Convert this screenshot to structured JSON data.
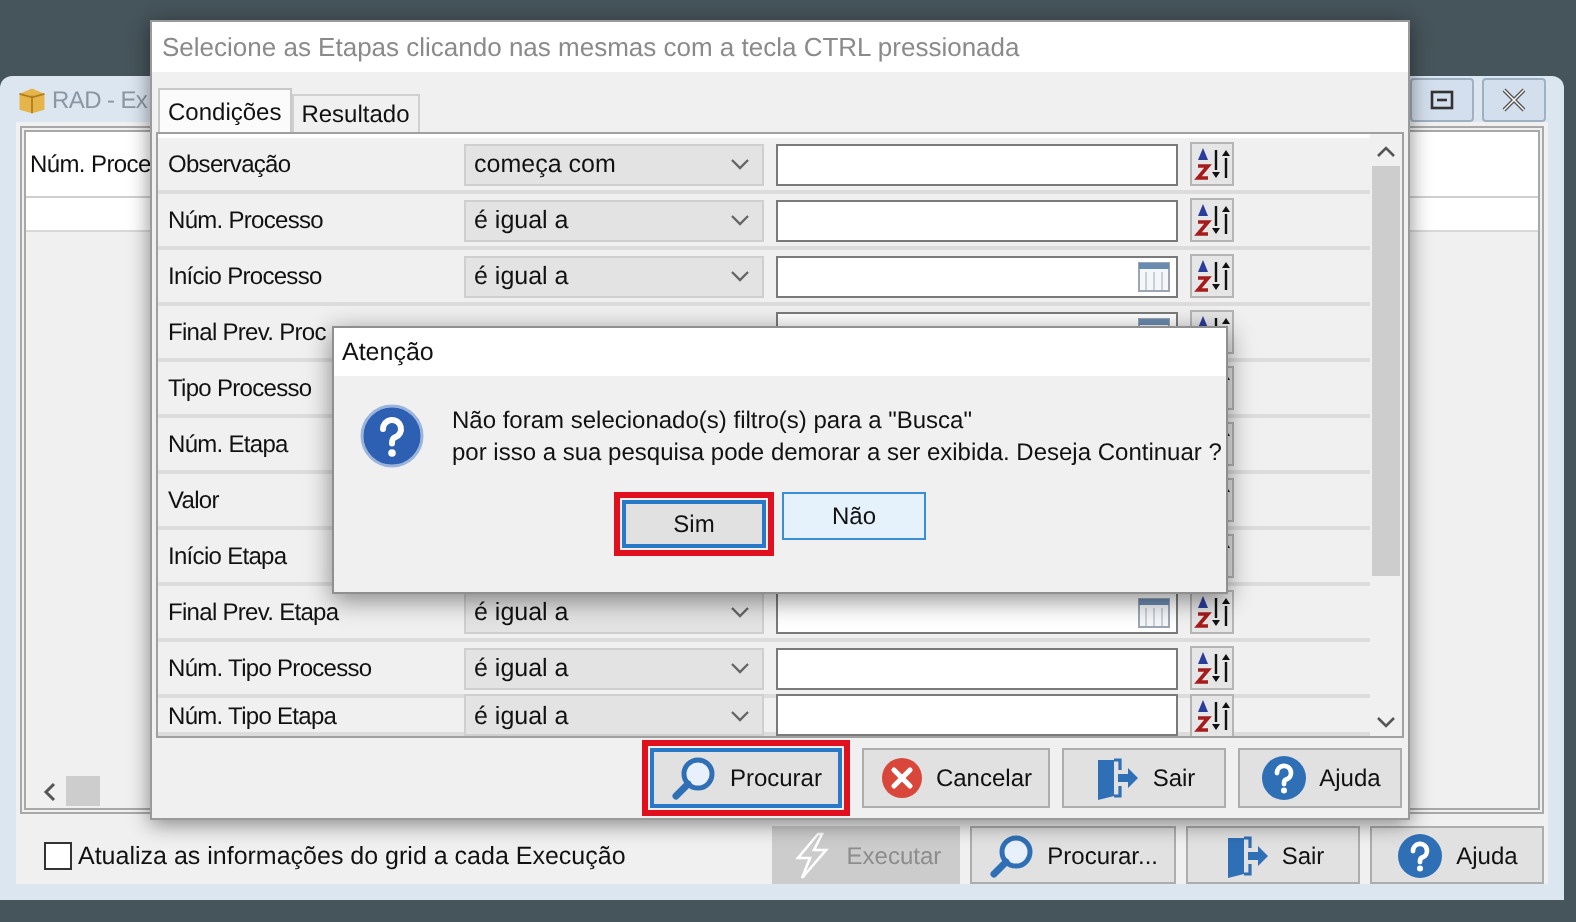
{
  "back_window": {
    "title": "RAD - Ex",
    "grid": {
      "columns": [
        "Núm. Proce"
      ]
    },
    "checkbox": {
      "label": "Atualiza as informações do grid a cada Execução",
      "checked": false
    },
    "buttons": [
      {
        "label": "Executar",
        "disabled": true
      },
      {
        "label": "Procurar...",
        "disabled": false
      },
      {
        "label": "Sair",
        "disabled": false
      },
      {
        "label": "Ajuda",
        "disabled": false
      }
    ]
  },
  "dialog": {
    "title": "Selecione as Etapas clicando nas mesmas com a tecla CTRL pressionada",
    "tabs": [
      {
        "label": "Condições",
        "selected": true
      },
      {
        "label": "Resultado",
        "selected": false
      }
    ],
    "rows": [
      {
        "label": "Observação",
        "operator": "começa com",
        "kind": "text"
      },
      {
        "label": "Núm. Processo",
        "operator": "é igual a",
        "kind": "text"
      },
      {
        "label": "Início Processo",
        "operator": "é igual a",
        "kind": "date"
      },
      {
        "label": "Final Prev. Proc",
        "kind": "date"
      },
      {
        "label": "Tipo Processo"
      },
      {
        "label": "Núm. Etapa"
      },
      {
        "label": "Valor"
      },
      {
        "label": "Início Etapa"
      },
      {
        "label": "Final Prev. Etapa",
        "operator": "é igual a",
        "kind": "date"
      },
      {
        "label": "Núm. Tipo Processo",
        "operator": "é igual a",
        "kind": "text"
      },
      {
        "label": "Núm. Tipo Etapa",
        "operator": "é igual a",
        "kind": "text"
      }
    ],
    "buttons": [
      {
        "label": "Procurar",
        "focused": true,
        "highlighted": true
      },
      {
        "label": "Cancelar",
        "focused": false,
        "highlighted": false
      },
      {
        "label": "Sair",
        "focused": false,
        "highlighted": false
      },
      {
        "label": "Ajuda",
        "focused": false,
        "highlighted": false
      }
    ]
  },
  "alert": {
    "title": "Atenção",
    "message": [
      "Não foram selecionado(s) filtro(s) para a \"Busca\"",
      "por isso a sua pesquisa pode demorar a ser exibida. Deseja Continuar ?"
    ],
    "buttons": [
      {
        "label": "Sim",
        "focused": true,
        "highlighted": true
      },
      {
        "label": "Não",
        "focused": false,
        "highlighted": false
      }
    ]
  }
}
